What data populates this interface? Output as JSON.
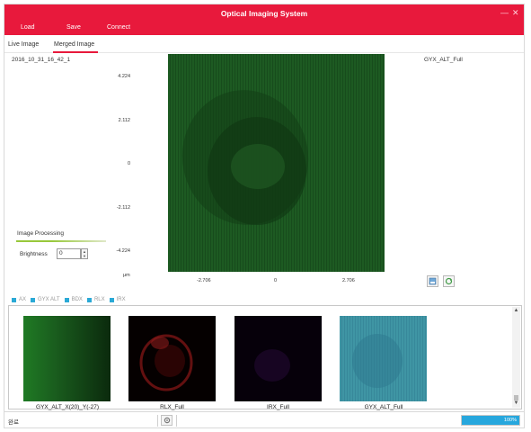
{
  "window": {
    "title": "Optical Imaging System",
    "minimize_glyph": "—",
    "close_glyph": "✕"
  },
  "menu": {
    "load": "Load",
    "save": "Save",
    "connect": "Connect"
  },
  "tabs": {
    "live": "Live Image",
    "merged": "Merged Image"
  },
  "left_panel": {
    "timestamp": "2016_10_31_16_42_1",
    "processing_title": "Image Processing",
    "brightness_label": "Brightness",
    "brightness_value": "0"
  },
  "plot": {
    "name": "GYX_ALT_Full",
    "y_ticks": [
      "4.224",
      "2.112",
      "0",
      "-2.112",
      "-4.224"
    ],
    "x_ticks": [
      "-2.706",
      "0",
      "2.706"
    ],
    "unit": "μm"
  },
  "channels": [
    {
      "label": "AX"
    },
    {
      "label": "GYX ALT"
    },
    {
      "label": "BDX"
    },
    {
      "label": "RLX"
    },
    {
      "label": "IRX"
    }
  ],
  "thumbnails": [
    {
      "label": "GYX_ALT_X(20)_Y(-27)"
    },
    {
      "label": "RLX_Full"
    },
    {
      "label": "IRX_Full"
    },
    {
      "label": "GYX_ALT_Full"
    }
  ],
  "status": {
    "text": "완료",
    "progress_percent": 100,
    "progress_text": "100%"
  },
  "colors": {
    "accent": "#e8193c",
    "progress": "#27a7dd",
    "selection": "#2a86e3",
    "channel_box": "#2aa9d6"
  }
}
